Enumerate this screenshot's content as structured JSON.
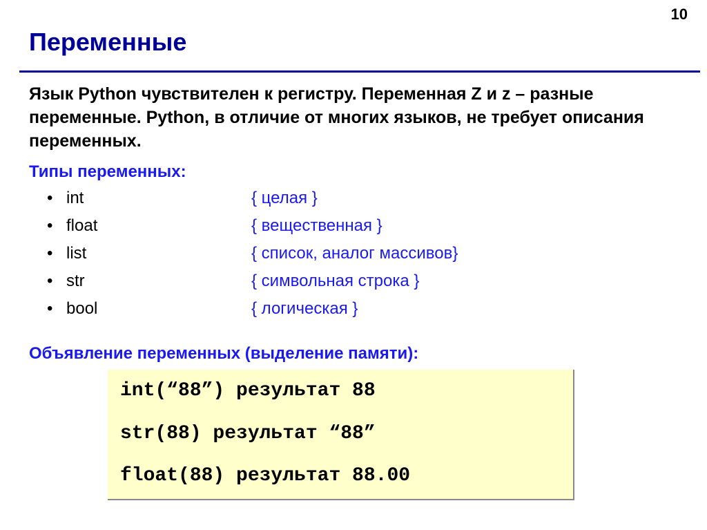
{
  "page_number": "10",
  "title": "Переменные",
  "intro": "Язык Python чувствителен к регистру. Переменная Z и z – разные переменные. Python, в отличие от многих языков, не требует описания переменных.",
  "types_label": "Типы переменных:",
  "types": [
    {
      "name": "int",
      "desc": "{ целая }"
    },
    {
      "name": "float",
      "desc": "{ вещественная }"
    },
    {
      "name": "list",
      "desc": "{ список, аналог массивов}"
    },
    {
      "name": "str",
      "desc": "{ символьная строка }"
    },
    {
      "name": "bool",
      "desc": "{ логическая }"
    }
  ],
  "decl_label": "Объявление переменных (выделение памяти):",
  "code": {
    "line1": "int(“88”) результат 88",
    "line2": "str(88) результат “88”",
    "line3": "float(88) результат 88.00"
  }
}
